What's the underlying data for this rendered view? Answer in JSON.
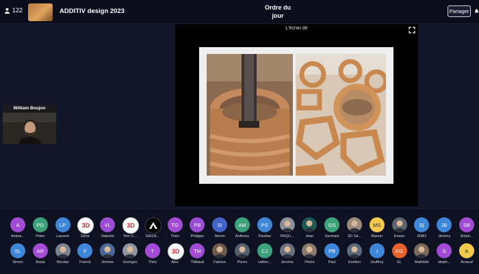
{
  "header": {
    "participant_count": "122",
    "event_title": "ADDITIV design 2023",
    "agenda_line1": "Ordre du",
    "agenda_line2": "jour",
    "share_label": "Partager"
  },
  "screen_share": {
    "title": "L'écran de"
  },
  "speaker": {
    "name": "William Boujon"
  },
  "attendees": [
    {
      "initials": "A",
      "name": "Amine...",
      "color": "#a24bd4"
    },
    {
      "initials": "PD",
      "name": "Peter",
      "color": "#3ba27c"
    },
    {
      "initials": "LP",
      "name": "Laurent",
      "color": "#3d86d8"
    },
    {
      "initials": "3D",
      "name": "Elliot",
      "color": "#ffffff",
      "style": "logo3d"
    },
    {
      "initials": "VL",
      "name": "Valentin",
      "color": "#9a4cd2"
    },
    {
      "initials": "3D",
      "name": "Tom C...",
      "color": "#ffffff",
      "style": "logo3d"
    },
    {
      "initials": "",
      "name": "SAGN...",
      "color": "#000000",
      "style": "black"
    },
    {
      "initials": "TG",
      "name": "Théo",
      "color": "#a24bd4"
    },
    {
      "initials": "PB",
      "name": "Philippe",
      "color": "#9a4cd2"
    },
    {
      "initials": "SI",
      "name": "Simon",
      "color": "#4563c6"
    },
    {
      "initials": "AM",
      "name": "Anthony",
      "color": "#3ba27c"
    },
    {
      "initials": "PS",
      "name": "Pauline",
      "color": "#3d86d8"
    },
    {
      "initials": "",
      "name": "PAQU...",
      "color": "#8a8f99",
      "style": "photo"
    },
    {
      "initials": "",
      "name": "Jean",
      "color": "#1d5a55",
      "style": "photo"
    },
    {
      "initials": "GS",
      "name": "Germain",
      "color": "#3ba27c"
    },
    {
      "initials": "",
      "name": "3D Tal...",
      "color": "#9a8a7a",
      "style": "photo"
    },
    {
      "initials": "MS",
      "name": "Manon",
      "color": "#f2c94c",
      "dark": true
    },
    {
      "initials": "",
      "name": "Erwan",
      "color": "#5d6470",
      "style": "photo"
    },
    {
      "initials": "S(",
      "name": "SIMO",
      "color": "#3d86d8"
    },
    {
      "initials": "JB",
      "name": "Jérémy",
      "color": "#3d86d8"
    },
    {
      "initials": "SB",
      "name": "Stéph...",
      "color": "#a24bd4"
    },
    {
      "initials": "R",
      "name": "Ric",
      "color": "#6a4bd4"
    },
    {
      "initials": "SL",
      "name": "Simon",
      "color": "#3d86d8"
    },
    {
      "initials": "AR",
      "name": "Assia",
      "color": "#a24bd4"
    },
    {
      "initials": "",
      "name": "Nicolas",
      "color": "#7a8390",
      "style": "photo"
    },
    {
      "initials": "F",
      "name": "Franck",
      "color": "#3d86d8"
    },
    {
      "initials": "",
      "name": "Jérôme",
      "color": "#4a6a9a",
      "style": "photo"
    },
    {
      "initials": "",
      "name": "Georges",
      "color": "#8f969f",
      "style": "photo"
    },
    {
      "initials": "T",
      "name": "Théo",
      "color": "#a24bd4"
    },
    {
      "initials": "3D",
      "name": "Alex",
      "color": "#ffffff",
      "style": "logo3d"
    },
    {
      "initials": "TM",
      "name": "Thibaud",
      "color": "#a24bd4"
    },
    {
      "initials": "",
      "name": "Fabrice",
      "color": "#6e5a4a",
      "style": "photo"
    },
    {
      "initials": "",
      "name": "Pierre",
      "color": "#55606c",
      "style": "photo"
    },
    {
      "initials": "CJ",
      "name": "cather...",
      "color": "#3ba27c"
    },
    {
      "initials": "",
      "name": "Jerome",
      "color": "#6a7280",
      "style": "photo"
    },
    {
      "initials": "",
      "name": "Pietro",
      "color": "#8a7a6a",
      "style": "photo"
    },
    {
      "initials": "PB",
      "name": "Paul",
      "color": "#3d86d8"
    },
    {
      "initials": "",
      "name": "Emilien",
      "color": "#5a6a7a",
      "style": "photo"
    },
    {
      "initials": "J",
      "name": "Jouffroy",
      "color": "#3d86d8"
    },
    {
      "initials": "EG",
      "name": "EL",
      "color": "#e8612c"
    },
    {
      "initials": "",
      "name": "Mathilde",
      "color": "#7a6a5a",
      "style": "photo"
    },
    {
      "initials": "S",
      "name": "steph...",
      "color": "#a24bd4"
    },
    {
      "initials": "A",
      "name": "Arnaud",
      "color": "#f2c94c",
      "dark": true
    },
    {
      "initials": "F",
      "name": "Fl",
      "color": "#f2c94c",
      "dark": true
    }
  ]
}
